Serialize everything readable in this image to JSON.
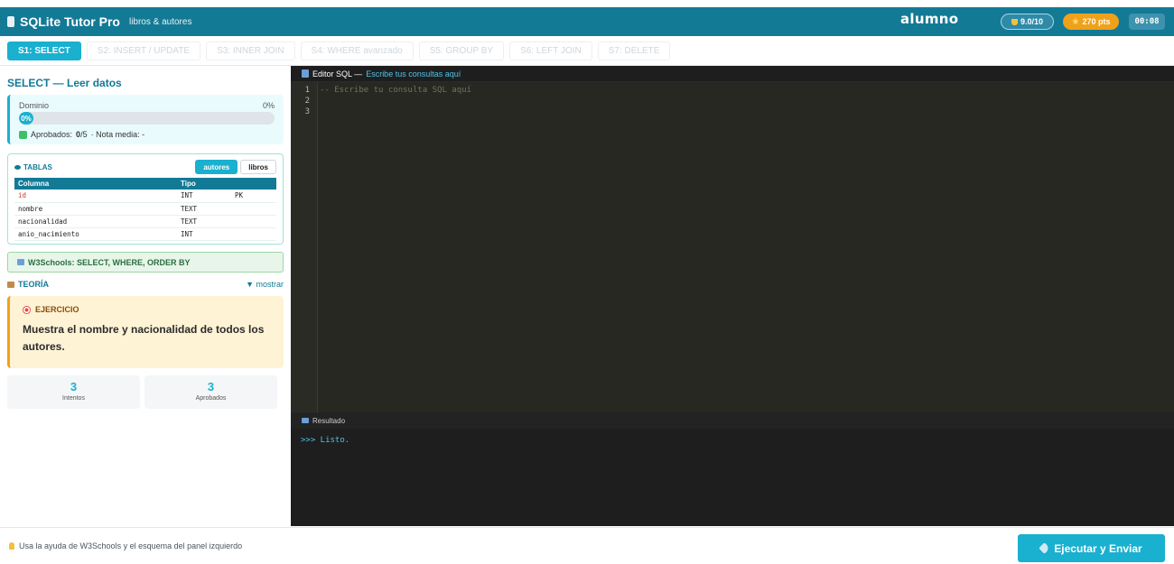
{
  "app": {
    "title": "SQLite Tutor Pro",
    "subtitle": "libros & autores",
    "user": "alumno",
    "score": "9.0/10",
    "points": "270 pts",
    "timer": "00:08"
  },
  "tabs": [
    {
      "label": "S1: SELECT",
      "active": true
    },
    {
      "label": "S2: INSERT / UPDATE"
    },
    {
      "label": "S3: INNER JOIN"
    },
    {
      "label": "S4: WHERE avanzado"
    },
    {
      "label": "S5: GROUP BY"
    },
    {
      "label": "S6: LEFT JOIN"
    },
    {
      "label": "S7: DELETE"
    }
  ],
  "lesson": {
    "title": "SELECT — Leer datos",
    "progress": {
      "label": "Dominio",
      "percent_text": "0%",
      "bar_text": "0%",
      "fraction": 0.0,
      "approved_label": "Aprobados:",
      "approved_value": "0",
      "approved_total": "/5",
      "avg_label": "· Nota media: -"
    }
  },
  "schema": {
    "title": "TABLAS",
    "tables": [
      "autores",
      "libros"
    ],
    "selected": "autores",
    "headers": [
      "Columna",
      "Tipo",
      ""
    ],
    "rows": [
      {
        "col": "id",
        "type": "INT",
        "key": "PK"
      },
      {
        "col": "nombre",
        "type": "TEXT",
        "key": ""
      },
      {
        "col": "nacionalidad",
        "type": "TEXT",
        "key": ""
      },
      {
        "col": "anio_nacimiento",
        "type": "INT",
        "key": ""
      }
    ]
  },
  "w3": {
    "label": "W3Schools: SELECT, WHERE, ORDER BY"
  },
  "theory": {
    "label": "TEORÍA",
    "toggle": "▼ mostrar"
  },
  "exercise": {
    "heading": "EJERCICIO",
    "text": "Muestra el nombre y nacionalidad de todos los autores."
  },
  "stats": [
    {
      "value": "3",
      "label": "Intentos"
    },
    {
      "value": "3",
      "label": "Aprobados"
    }
  ],
  "editor": {
    "title": "Editor SQL —",
    "hint": "Escribe tus consultas aquí",
    "lines": [
      "1",
      "2",
      "3"
    ],
    "code": "-- Escribe tu consulta SQL aquí"
  },
  "result": {
    "title": "Resultado",
    "output": ">>> Listo."
  },
  "footer": {
    "tip": "Usa la ayuda de W3Schools y el esquema del panel izquierdo",
    "run_button": "Ejecutar y Enviar"
  }
}
